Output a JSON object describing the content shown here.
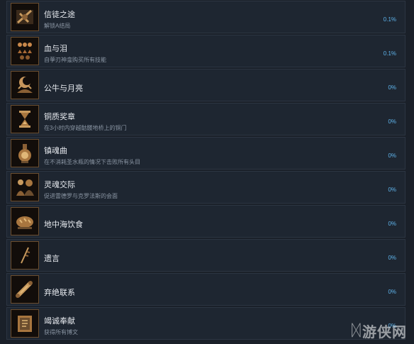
{
  "colors": {
    "background": "#1a2029",
    "row_background": "#1e2631",
    "title_text": "#e6e9ee",
    "desc_text": "#8a95a3",
    "percent_text": "#5fb4ec",
    "icon_frame": "#6b4d2e"
  },
  "achievements": [
    {
      "title": "信徒之途",
      "desc": "解锁A结局",
      "percent": "0.1%",
      "icon": "cross-sword-icon"
    },
    {
      "title": "血与泪",
      "desc": "自荸刃神龛购买所有技能",
      "percent": "0.1%",
      "icon": "blood-drops-icon"
    },
    {
      "title": "公牛与月亮",
      "desc": "",
      "percent": "0%",
      "icon": "bull-moon-icon"
    },
    {
      "title": "铜质奖章",
      "desc": "在3小时内穿越骷髅地桥上的铜门",
      "percent": "0%",
      "icon": "hourglass-icon"
    },
    {
      "title": "镇魂曲",
      "desc": "在不消耗圣水瓶的情况下击败所有头目",
      "percent": "0%",
      "icon": "flask-icon"
    },
    {
      "title": "灵魂交际",
      "desc": "促进雷德罗与克罗法斯的会面",
      "percent": "0%",
      "icon": "two-figures-icon"
    },
    {
      "title": "地中海饮食",
      "desc": "",
      "percent": "0%",
      "icon": "bread-icon"
    },
    {
      "title": "遗言",
      "desc": "",
      "percent": "0%",
      "icon": "quill-icon"
    },
    {
      "title": "弃绝联系",
      "desc": "",
      "percent": "0%",
      "icon": "scroll-icon"
    },
    {
      "title": "竭诚奉献",
      "desc": "获得所有博文",
      "percent": "0%",
      "icon": "book-icon"
    }
  ],
  "watermark": {
    "text": "游侠网",
    "icon": "ali-logo-icon"
  }
}
